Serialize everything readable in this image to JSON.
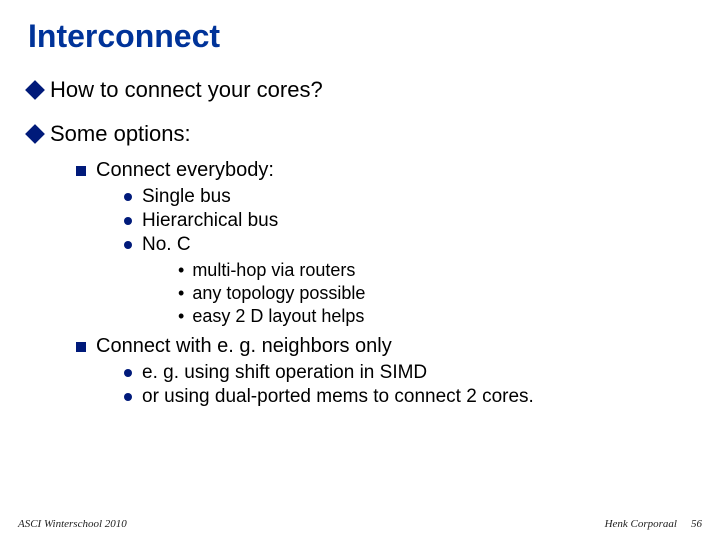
{
  "title": "Interconnect",
  "bullets": {
    "how": "How to connect your cores?",
    "someOptions": "Some options:",
    "connectEverybody": "Connect everybody:",
    "singleBus": "Single bus",
    "hierBus": "Hierarchical bus",
    "noc": "No. C",
    "multihop": "multi-hop via routers",
    "anyTopo": "any topology possible",
    "easy2d": "easy 2 D layout helps",
    "neighbors": "Connect with e. g. neighbors only",
    "egSimd": "e. g. using shift operation in SIMD",
    "dualPorted": "or using dual-ported mems to connect 2 cores."
  },
  "footer": {
    "left": "ASCI Winterschool 2010",
    "author": "Henk Corporaal",
    "page": "56"
  }
}
